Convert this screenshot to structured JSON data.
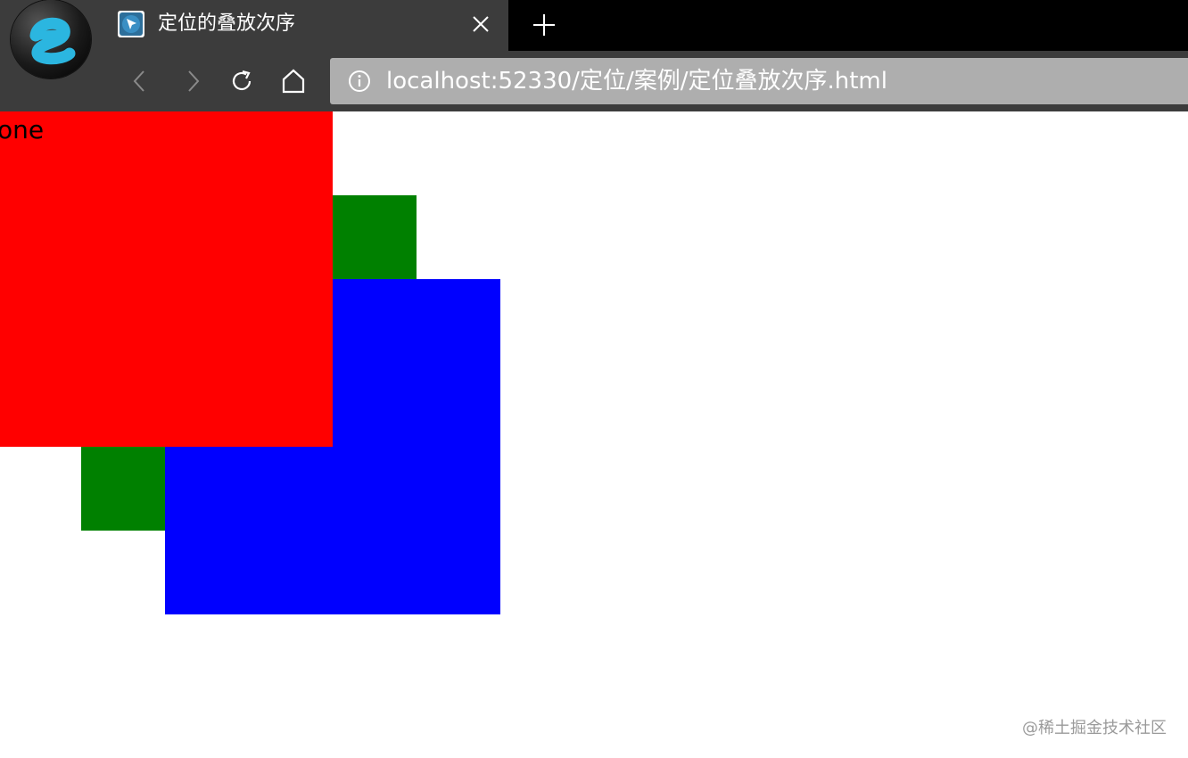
{
  "browser": {
    "tab": {
      "title": "定位的叠放次序",
      "favicon": "cursor-arrow-icon"
    },
    "toolbar": {
      "back": "chevron-left-icon",
      "forward": "chevron-right-icon",
      "reload": "reload-icon",
      "home": "home-icon"
    },
    "address_bar": {
      "icon": "info-icon",
      "url": "localhost:52330/定位/案例/定位叠放次序.html"
    },
    "colors": {
      "chrome_bg": "#3c3c3c",
      "tabstrip_bg": "#000000",
      "address_bg": "#aeaeae"
    }
  },
  "page": {
    "boxes": [
      {
        "label": "one",
        "color": "#ff0000"
      },
      {
        "label": "",
        "color": "#008000"
      },
      {
        "label": "",
        "color": "#0000ff"
      }
    ],
    "watermark": "@稀土掘金技术社区"
  }
}
